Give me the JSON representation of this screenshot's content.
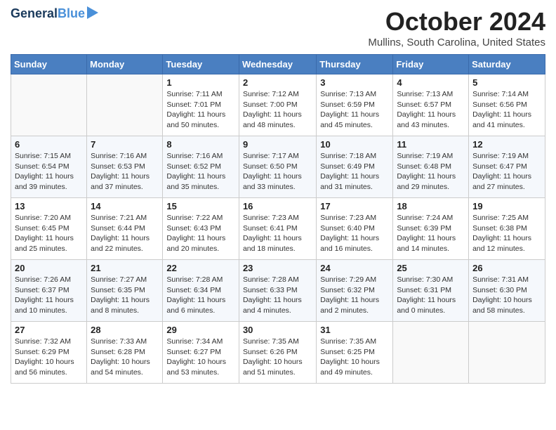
{
  "header": {
    "logo_line1": "General",
    "logo_line2": "Blue",
    "month": "October 2024",
    "location": "Mullins, South Carolina, United States"
  },
  "days_of_week": [
    "Sunday",
    "Monday",
    "Tuesday",
    "Wednesday",
    "Thursday",
    "Friday",
    "Saturday"
  ],
  "weeks": [
    [
      {
        "num": "",
        "info": ""
      },
      {
        "num": "",
        "info": ""
      },
      {
        "num": "1",
        "info": "Sunrise: 7:11 AM\nSunset: 7:01 PM\nDaylight: 11 hours and 50 minutes."
      },
      {
        "num": "2",
        "info": "Sunrise: 7:12 AM\nSunset: 7:00 PM\nDaylight: 11 hours and 48 minutes."
      },
      {
        "num": "3",
        "info": "Sunrise: 7:13 AM\nSunset: 6:59 PM\nDaylight: 11 hours and 45 minutes."
      },
      {
        "num": "4",
        "info": "Sunrise: 7:13 AM\nSunset: 6:57 PM\nDaylight: 11 hours and 43 minutes."
      },
      {
        "num": "5",
        "info": "Sunrise: 7:14 AM\nSunset: 6:56 PM\nDaylight: 11 hours and 41 minutes."
      }
    ],
    [
      {
        "num": "6",
        "info": "Sunrise: 7:15 AM\nSunset: 6:54 PM\nDaylight: 11 hours and 39 minutes."
      },
      {
        "num": "7",
        "info": "Sunrise: 7:16 AM\nSunset: 6:53 PM\nDaylight: 11 hours and 37 minutes."
      },
      {
        "num": "8",
        "info": "Sunrise: 7:16 AM\nSunset: 6:52 PM\nDaylight: 11 hours and 35 minutes."
      },
      {
        "num": "9",
        "info": "Sunrise: 7:17 AM\nSunset: 6:50 PM\nDaylight: 11 hours and 33 minutes."
      },
      {
        "num": "10",
        "info": "Sunrise: 7:18 AM\nSunset: 6:49 PM\nDaylight: 11 hours and 31 minutes."
      },
      {
        "num": "11",
        "info": "Sunrise: 7:19 AM\nSunset: 6:48 PM\nDaylight: 11 hours and 29 minutes."
      },
      {
        "num": "12",
        "info": "Sunrise: 7:19 AM\nSunset: 6:47 PM\nDaylight: 11 hours and 27 minutes."
      }
    ],
    [
      {
        "num": "13",
        "info": "Sunrise: 7:20 AM\nSunset: 6:45 PM\nDaylight: 11 hours and 25 minutes."
      },
      {
        "num": "14",
        "info": "Sunrise: 7:21 AM\nSunset: 6:44 PM\nDaylight: 11 hours and 22 minutes."
      },
      {
        "num": "15",
        "info": "Sunrise: 7:22 AM\nSunset: 6:43 PM\nDaylight: 11 hours and 20 minutes."
      },
      {
        "num": "16",
        "info": "Sunrise: 7:23 AM\nSunset: 6:41 PM\nDaylight: 11 hours and 18 minutes."
      },
      {
        "num": "17",
        "info": "Sunrise: 7:23 AM\nSunset: 6:40 PM\nDaylight: 11 hours and 16 minutes."
      },
      {
        "num": "18",
        "info": "Sunrise: 7:24 AM\nSunset: 6:39 PM\nDaylight: 11 hours and 14 minutes."
      },
      {
        "num": "19",
        "info": "Sunrise: 7:25 AM\nSunset: 6:38 PM\nDaylight: 11 hours and 12 minutes."
      }
    ],
    [
      {
        "num": "20",
        "info": "Sunrise: 7:26 AM\nSunset: 6:37 PM\nDaylight: 11 hours and 10 minutes."
      },
      {
        "num": "21",
        "info": "Sunrise: 7:27 AM\nSunset: 6:35 PM\nDaylight: 11 hours and 8 minutes."
      },
      {
        "num": "22",
        "info": "Sunrise: 7:28 AM\nSunset: 6:34 PM\nDaylight: 11 hours and 6 minutes."
      },
      {
        "num": "23",
        "info": "Sunrise: 7:28 AM\nSunset: 6:33 PM\nDaylight: 11 hours and 4 minutes."
      },
      {
        "num": "24",
        "info": "Sunrise: 7:29 AM\nSunset: 6:32 PM\nDaylight: 11 hours and 2 minutes."
      },
      {
        "num": "25",
        "info": "Sunrise: 7:30 AM\nSunset: 6:31 PM\nDaylight: 11 hours and 0 minutes."
      },
      {
        "num": "26",
        "info": "Sunrise: 7:31 AM\nSunset: 6:30 PM\nDaylight: 10 hours and 58 minutes."
      }
    ],
    [
      {
        "num": "27",
        "info": "Sunrise: 7:32 AM\nSunset: 6:29 PM\nDaylight: 10 hours and 56 minutes."
      },
      {
        "num": "28",
        "info": "Sunrise: 7:33 AM\nSunset: 6:28 PM\nDaylight: 10 hours and 54 minutes."
      },
      {
        "num": "29",
        "info": "Sunrise: 7:34 AM\nSunset: 6:27 PM\nDaylight: 10 hours and 53 minutes."
      },
      {
        "num": "30",
        "info": "Sunrise: 7:35 AM\nSunset: 6:26 PM\nDaylight: 10 hours and 51 minutes."
      },
      {
        "num": "31",
        "info": "Sunrise: 7:35 AM\nSunset: 6:25 PM\nDaylight: 10 hours and 49 minutes."
      },
      {
        "num": "",
        "info": ""
      },
      {
        "num": "",
        "info": ""
      }
    ]
  ]
}
